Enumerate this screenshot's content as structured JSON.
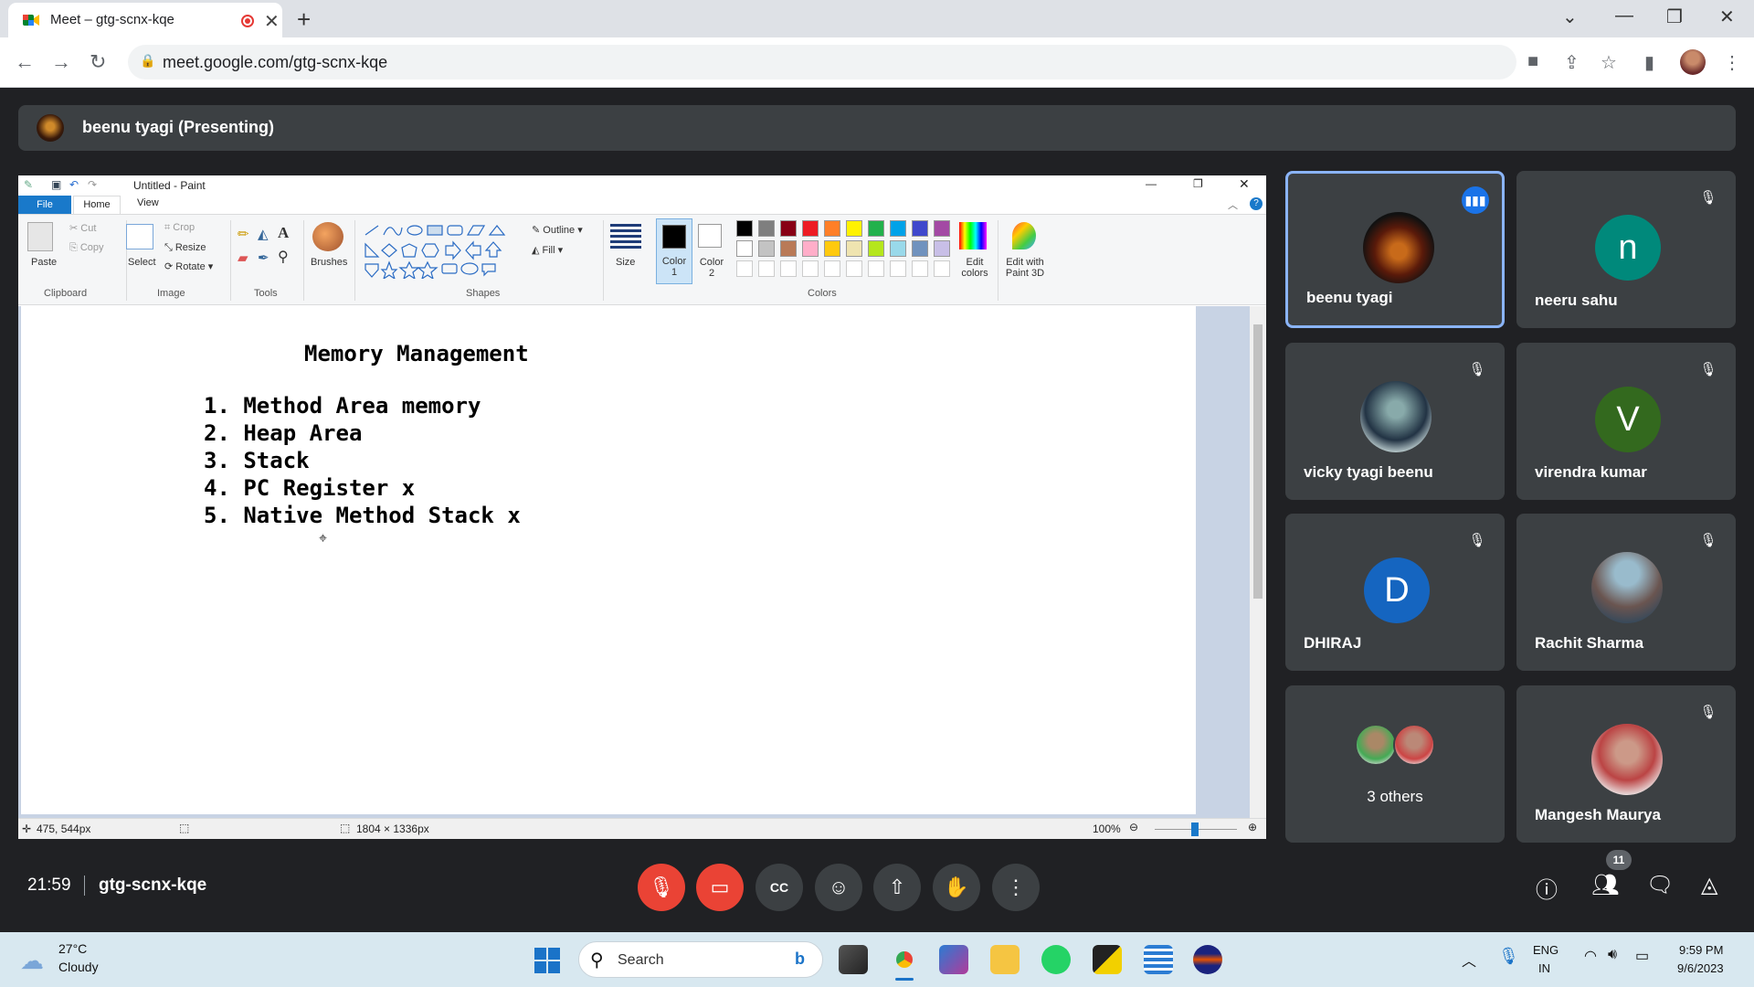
{
  "browser": {
    "tab_title": "Meet – gtg-scnx-kqe",
    "url": "meet.google.com/gtg-scnx-kqe"
  },
  "meet": {
    "presenting_label": "beenu tyagi (Presenting)",
    "clock": "21:59",
    "meeting_code": "gtg-scnx-kqe",
    "participant_count": "11",
    "participants": [
      {
        "name": "beenu tyagi",
        "initial": "",
        "speaking": true
      },
      {
        "name": "neeru sahu",
        "initial": "n",
        "color": "#00897b"
      },
      {
        "name": "vicky tyagi beenu",
        "initial": ""
      },
      {
        "name": "virendra kumar",
        "initial": "V",
        "color": "#33691e"
      },
      {
        "name": "DHIRAJ",
        "initial": "D",
        "color": "#1565c0"
      },
      {
        "name": "Rachit Sharma",
        "initial": ""
      },
      {
        "name": "3 others",
        "initial": ""
      },
      {
        "name": "Mangesh Maurya",
        "initial": ""
      }
    ]
  },
  "paint": {
    "window_title": "Untitled - Paint",
    "tabs": {
      "file": "File",
      "home": "Home",
      "view": "View"
    },
    "ribbon": {
      "paste": "Paste",
      "cut": "Cut",
      "copy": "Copy",
      "select": "Select",
      "crop": "Crop",
      "resize": "Resize",
      "rotate": "Rotate",
      "brushes": "Brushes",
      "outline": "Outline",
      "fill": "Fill",
      "size": "Size",
      "color1": "Color 1",
      "color2": "Color 2",
      "edit_colors": "Edit colors",
      "edit_paint3d": "Edit with Paint 3D",
      "groups": {
        "clipboard": "Clipboard",
        "image": "Image",
        "tools": "Tools",
        "shapes": "Shapes",
        "colors": "Colors"
      }
    },
    "palette": [
      "#000000",
      "#7f7f7f",
      "#880015",
      "#ed1c24",
      "#ff7f27",
      "#fff200",
      "#22b14c",
      "#00a2e8",
      "#3f48cc",
      "#a349a4",
      "#ffffff",
      "#c3c3c3",
      "#b97a57",
      "#ffaec9",
      "#ffc90e",
      "#efe4b0",
      "#b5e61d",
      "#99d9ea",
      "#7092be",
      "#c8bfe7"
    ],
    "document": {
      "heading": "Memory Management",
      "items": [
        "1. Method Area memory",
        "2. Heap Area",
        "3. Stack",
        "4. PC Register x",
        "5. Native Method Stack x"
      ]
    },
    "status": {
      "cursor": "475, 544px",
      "size": "1804 × 1336px",
      "zoom": "100%"
    }
  },
  "taskbar": {
    "temp": "27°C",
    "condition": "Cloudy",
    "search": "Search",
    "lang1": "ENG",
    "lang2": "IN",
    "time": "9:59 PM",
    "date": "9/6/2023"
  }
}
